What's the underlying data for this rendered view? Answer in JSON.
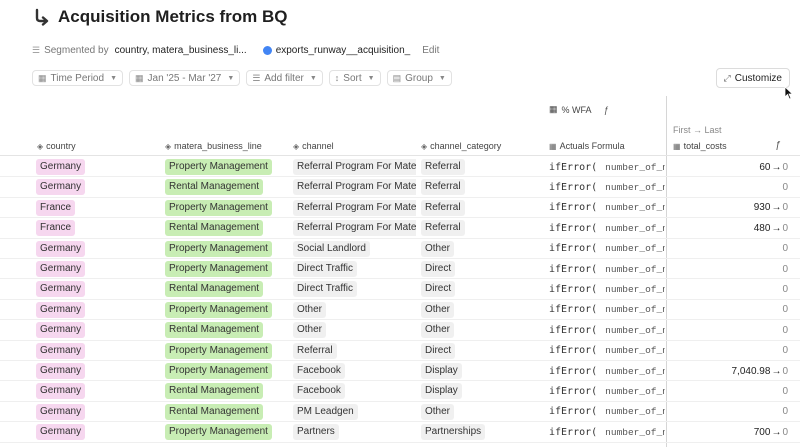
{
  "page": {
    "title": "Acquisition Metrics from BQ",
    "segmented_by_label": "Segmented by",
    "segmented_by_value": "country, matera_business_li...",
    "source_name": "exports_runway__acquisition_",
    "edit_label": "Edit"
  },
  "toolbar": {
    "time_period_label": "Time Period",
    "date_range_label": "Jan '25 - Mar '27",
    "add_filter_label": "Add filter",
    "sort_label": "Sort",
    "group_label": "Group",
    "customize_label": "Customize"
  },
  "table": {
    "group_header": "% WFA",
    "first_last_label": "First → Last",
    "columns": {
      "country": "country",
      "business_line": "matera_business_line",
      "channel": "channel",
      "channel_category": "channel_category",
      "actuals_formula": "Actuals Formula",
      "total_costs": "total_costs"
    },
    "formula_fn": "ifError(",
    "formula_arg": "number_of_new_",
    "arrow": "→",
    "rows": [
      {
        "country": "Germany",
        "business_line": "Property Management",
        "channel": "Referral Program For Matera",
        "channel_category": "Referral",
        "cost_first": "60",
        "cost_last": "0"
      },
      {
        "country": "Germany",
        "business_line": "Rental Management",
        "channel": "Referral Program For Matera",
        "channel_category": "Referral",
        "cost_first": "",
        "cost_last": "0"
      },
      {
        "country": "France",
        "business_line": "Property Management",
        "channel": "Referral Program For Matera",
        "channel_category": "Referral",
        "cost_first": "930",
        "cost_last": "0"
      },
      {
        "country": "France",
        "business_line": "Rental Management",
        "channel": "Referral Program For Matera",
        "channel_category": "Referral",
        "cost_first": "480",
        "cost_last": "0"
      },
      {
        "country": "Germany",
        "business_line": "Property Management",
        "channel": "Social Landlord",
        "channel_category": "Other",
        "cost_first": "",
        "cost_last": "0"
      },
      {
        "country": "Germany",
        "business_line": "Property Management",
        "channel": "Direct Traffic",
        "channel_category": "Direct",
        "cost_first": "",
        "cost_last": "0"
      },
      {
        "country": "Germany",
        "business_line": "Rental Management",
        "channel": "Direct Traffic",
        "channel_category": "Direct",
        "cost_first": "",
        "cost_last": "0"
      },
      {
        "country": "Germany",
        "business_line": "Property Management",
        "channel": "Other",
        "channel_category": "Other",
        "cost_first": "",
        "cost_last": "0"
      },
      {
        "country": "Germany",
        "business_line": "Rental Management",
        "channel": "Other",
        "channel_category": "Other",
        "cost_first": "",
        "cost_last": "0"
      },
      {
        "country": "Germany",
        "business_line": "Property Management",
        "channel": "Referral",
        "channel_category": "Direct",
        "cost_first": "",
        "cost_last": "0"
      },
      {
        "country": "Germany",
        "business_line": "Property Management",
        "channel": "Facebook",
        "channel_category": "Display",
        "cost_first": "7,040.98",
        "cost_last": "0"
      },
      {
        "country": "Germany",
        "business_line": "Rental Management",
        "channel": "Facebook",
        "channel_category": "Display",
        "cost_first": "",
        "cost_last": "0"
      },
      {
        "country": "Germany",
        "business_line": "Rental Management",
        "channel": "PM Leadgen",
        "channel_category": "Other",
        "cost_first": "",
        "cost_last": "0"
      },
      {
        "country": "Germany",
        "business_line": "Property Management",
        "channel": "Partners",
        "channel_category": "Partnerships",
        "cost_first": "700",
        "cost_last": "0"
      }
    ]
  }
}
